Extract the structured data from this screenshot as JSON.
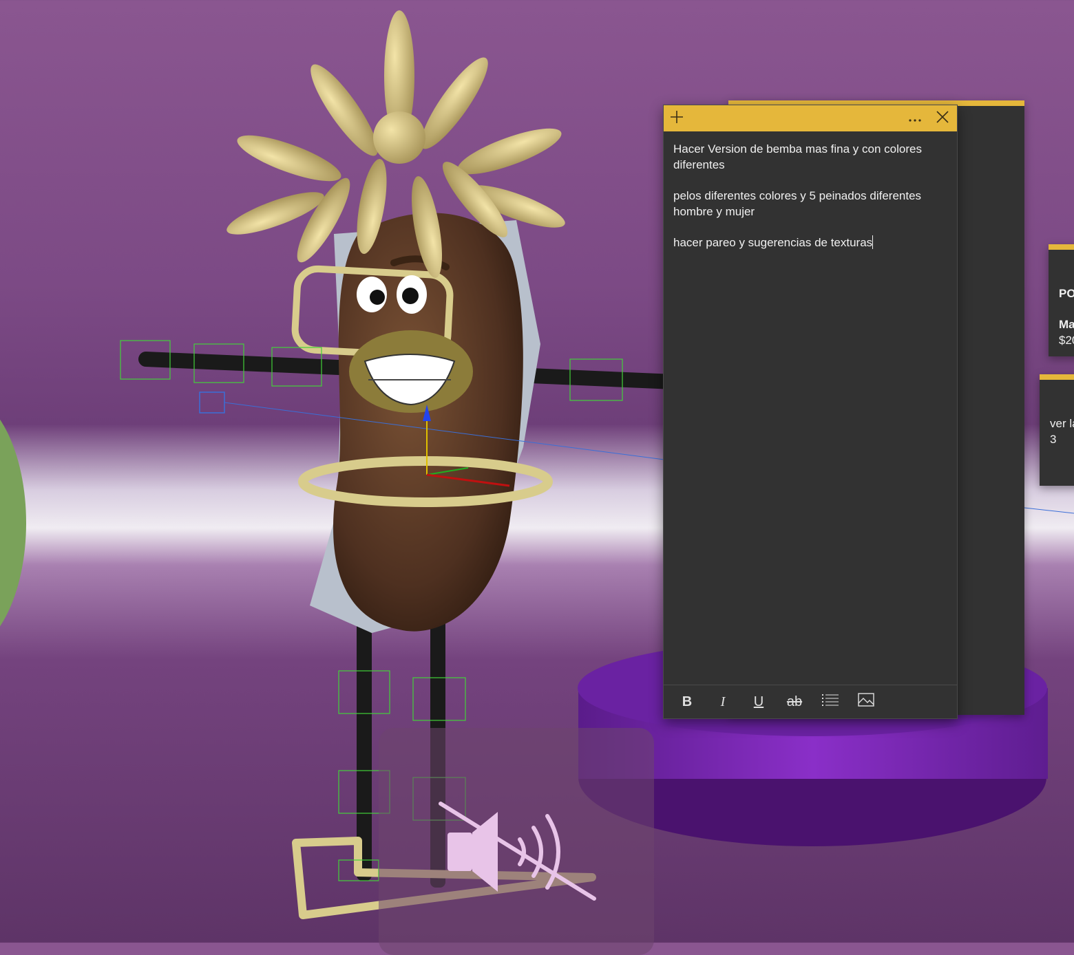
{
  "scene": {
    "background_color": "#7c4a85",
    "accent_color": "#e5b73b",
    "pedestal_color": "#7b22b0"
  },
  "note": {
    "header_icons": {
      "new": "plus-icon",
      "menu": "more-icon",
      "close": "close-icon"
    },
    "lines": [
      "Hacer Version de bemba mas fina y con colores diferentes",
      "pelos diferentes colores y 5 peinados diferentes hombre y mujer",
      "hacer pareo y sugerencias de texturas"
    ],
    "toolbar": {
      "bold": "B",
      "italic": "I",
      "underline": "U",
      "strikethrough": "ab",
      "list_icon": "bulleted-list-icon",
      "image_icon": "image-icon"
    }
  },
  "side_note_1": {
    "heading": "PO",
    "line1": "Ma",
    "line2": "$20"
  },
  "side_note_2": {
    "line1": "ver la",
    "line2": "3"
  },
  "mute_overlay": {
    "icon": "speaker-muted-icon"
  }
}
